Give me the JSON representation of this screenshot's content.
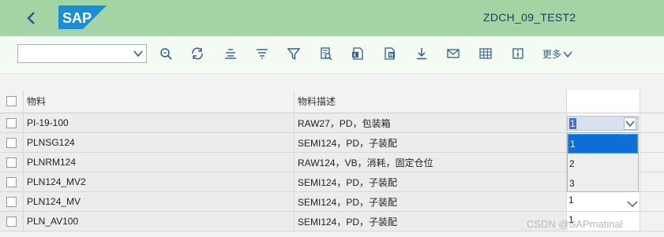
{
  "app": {
    "title": "ZDCH_09_TEST2",
    "back_icon": "back-arrow-icon",
    "logo": {
      "text": "SAP",
      "color": "#1a8fd8"
    },
    "titlebar_color": "#a3d5a4"
  },
  "toolbar": {
    "variant_value": "",
    "more_label": "更多",
    "icons": [
      "search-icon",
      "refresh-icon",
      "align-center-icon",
      "sort-icon",
      "filter-icon",
      "print-preview-icon",
      "excel-export-icon",
      "word-export-icon",
      "download-icon",
      "mail-icon",
      "layout-grid-icon",
      "info-icon"
    ]
  },
  "table": {
    "columns": [
      "物料",
      "物料描述",
      ""
    ],
    "rows": [
      {
        "material": "PI-19-100",
        "description": "RAW27，PD，包装箱",
        "value": "1"
      },
      {
        "material": "PLNSG124",
        "description": "SEMI124，PD，子装配",
        "value": ""
      },
      {
        "material": "PLNRM124",
        "description": "RAW124，VB，消耗，固定仓位",
        "value": ""
      },
      {
        "material": "PLN124_MV2",
        "description": "SEMI124，PD，子装配",
        "value": ""
      },
      {
        "material": "PLN124_MV",
        "description": "SEMI124，PD，子装配",
        "value": "1"
      },
      {
        "material": "PLN_AV100",
        "description": "SEMI124，PD，子装配",
        "value": "1"
      }
    ]
  },
  "dropdown": {
    "options": [
      "1",
      "2",
      "3"
    ],
    "selected": "1",
    "highlight_color": "#0f6dd6"
  },
  "watermark": "CSDN @SAPmatinal"
}
